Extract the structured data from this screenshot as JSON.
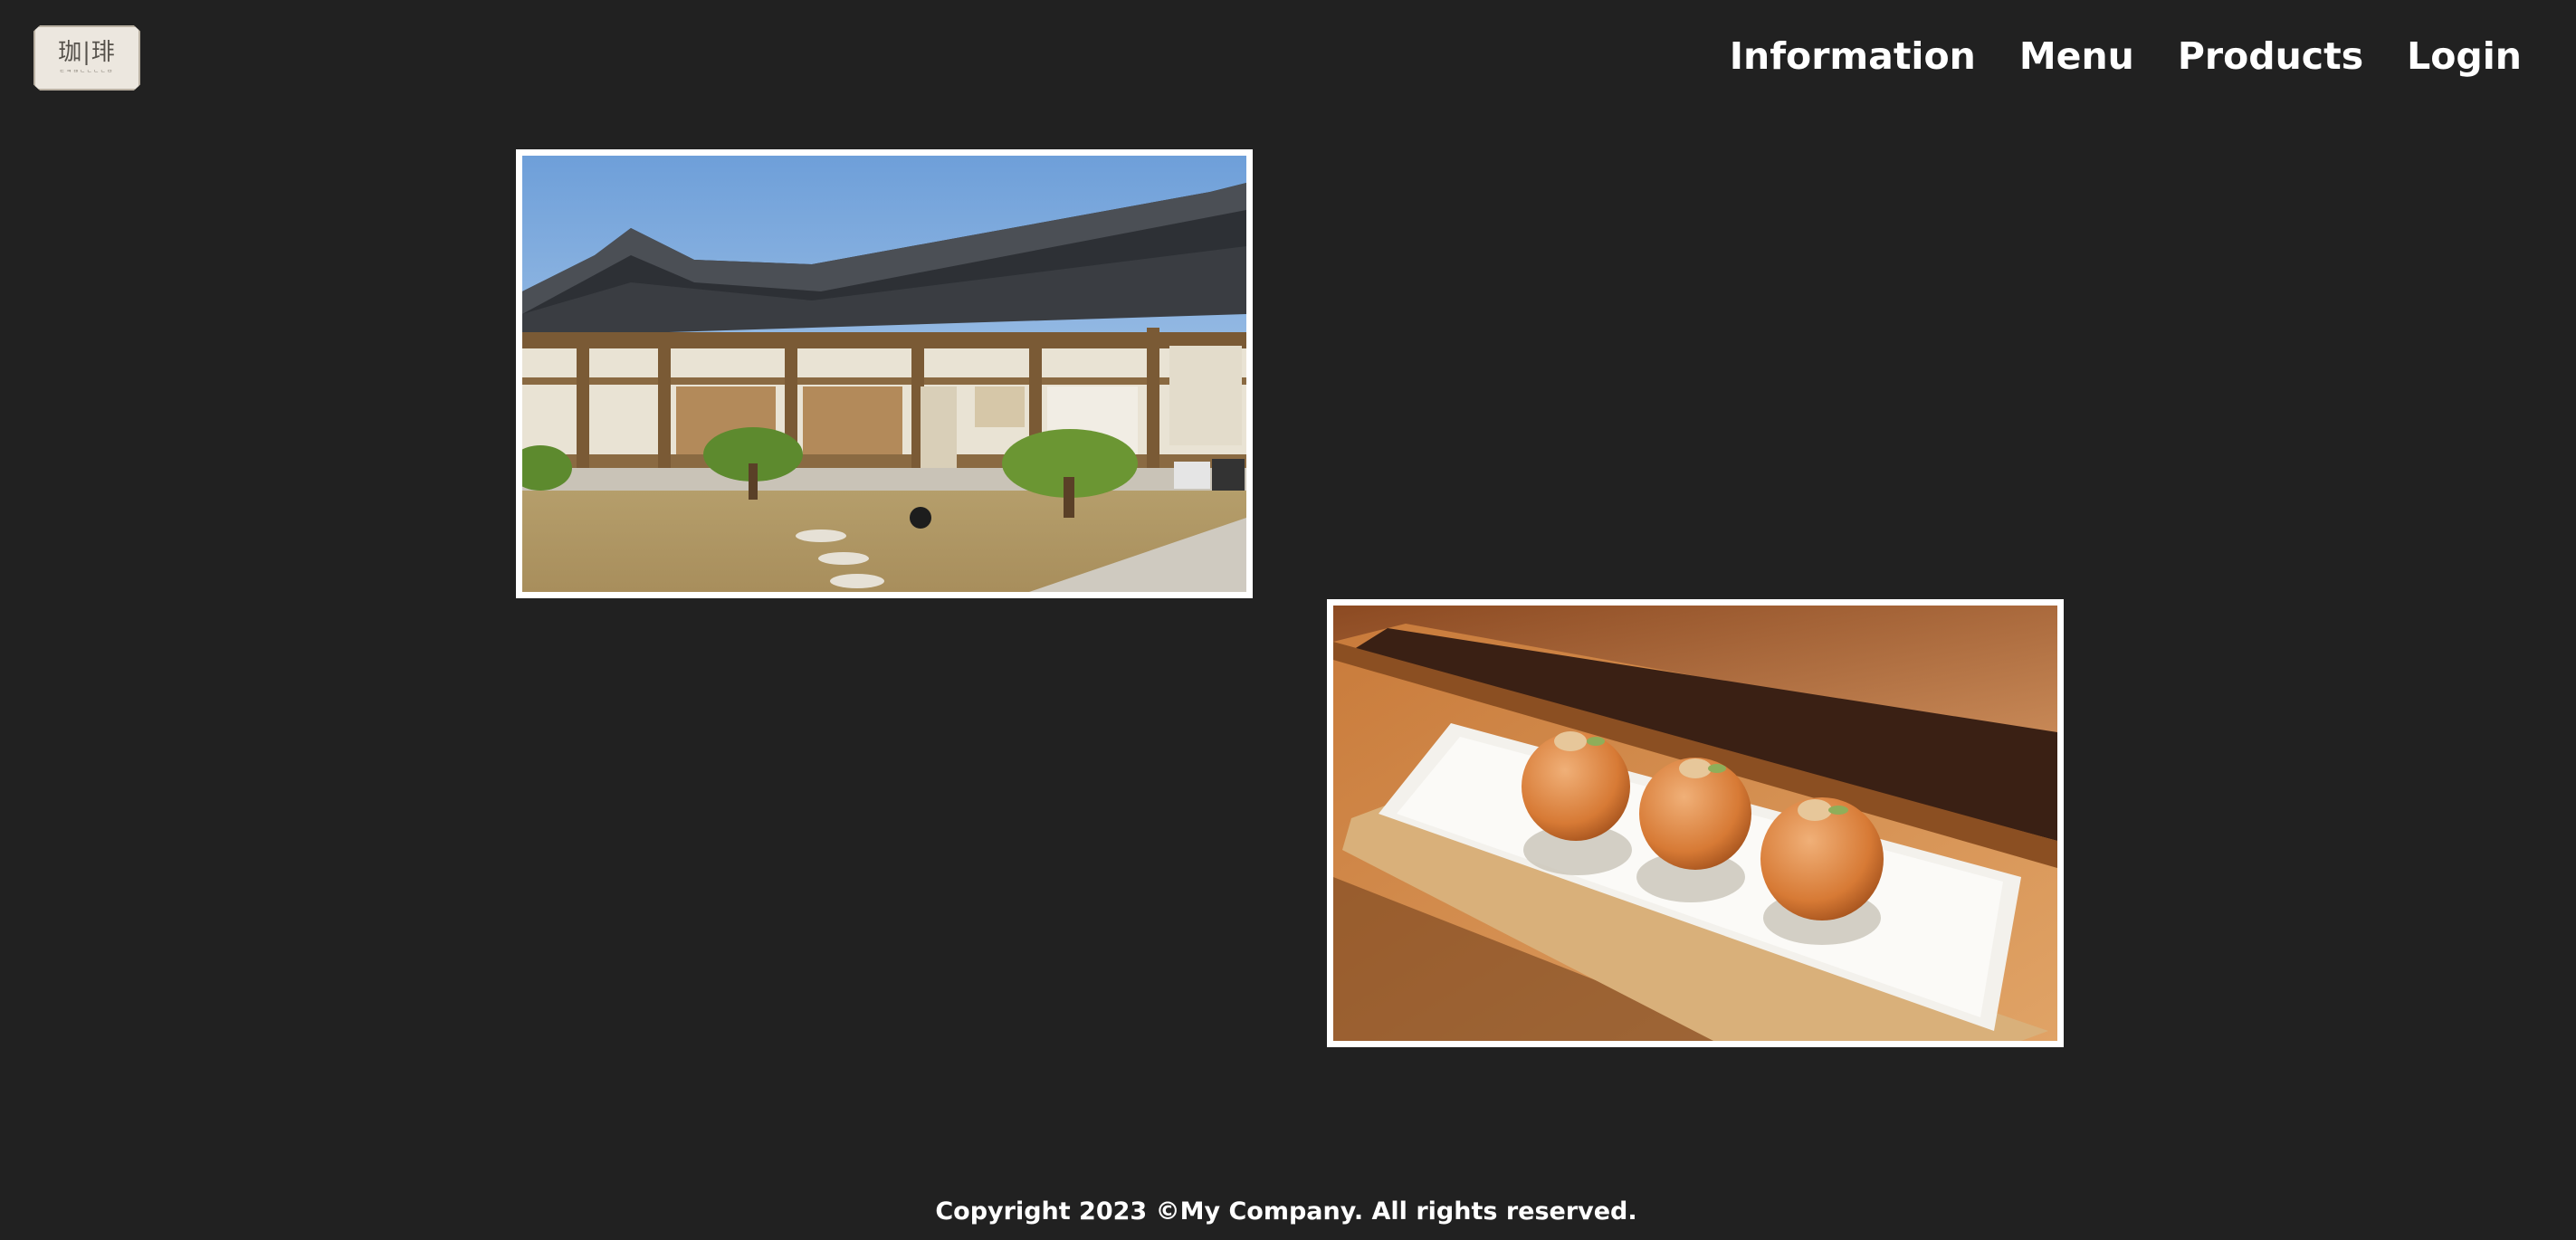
{
  "logo": {
    "mark": "珈|琲",
    "subtext": "ᄃᄏᄃᄆᄂᄂᄂᄂᄆ"
  },
  "nav": {
    "items": [
      {
        "label": "Information"
      },
      {
        "label": "Menu"
      },
      {
        "label": "Products"
      },
      {
        "label": "Login"
      }
    ]
  },
  "images": {
    "house": {
      "icon": "hanok-house-photo"
    },
    "dessert": {
      "icon": "dessert-plate-photo"
    }
  },
  "footer": {
    "copyright": "Copyright 2023 ©My Company. All rights reserved."
  },
  "colors": {
    "background": "#212121",
    "text": "#ffffff",
    "frame": "#ffffff"
  }
}
